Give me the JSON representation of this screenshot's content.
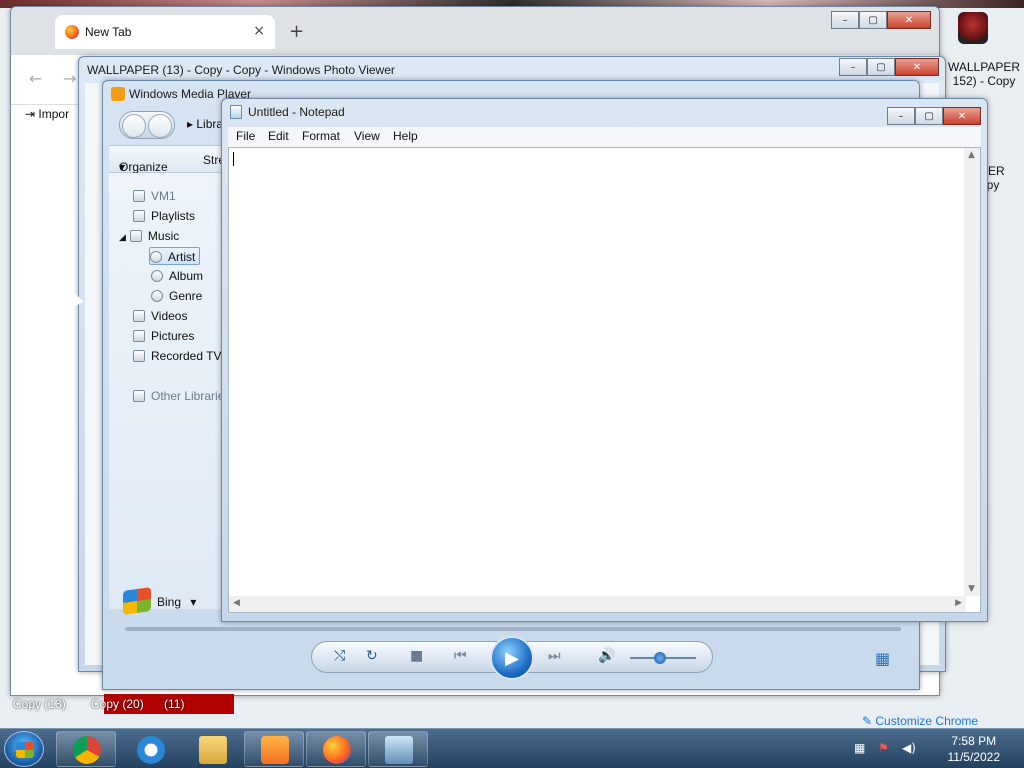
{
  "desktop": {
    "right_icons": [
      {
        "label": "WALLPAPER\n152) - Copy"
      },
      {
        "label": "PER\nopy"
      }
    ],
    "bottom_labels": [
      "Copy (13)",
      "Copy (20)",
      "(11)"
    ]
  },
  "chrome": {
    "tab_title": "New Tab",
    "tab_close": "×",
    "new_tab": "+",
    "back": "←",
    "forward": "→",
    "import_label": "Impor",
    "customize": "Customize Chrome"
  },
  "photo_viewer": {
    "title": "WALLPAPER (13) - Copy - Copy - Windows Photo Viewer"
  },
  "wmp": {
    "title": "Windows Media Player",
    "breadcrumb": "Libra",
    "toolbar": {
      "organize": "Organize",
      "stream": "Stre"
    },
    "nav": [
      {
        "label": "VM1"
      },
      {
        "label": "Playlists"
      },
      {
        "label": "Music"
      },
      {
        "label": "Artist"
      },
      {
        "label": "Album"
      },
      {
        "label": "Genre"
      },
      {
        "label": "Videos"
      },
      {
        "label": "Pictures"
      },
      {
        "label": "Recorded TV"
      },
      {
        "label": "Other Librarie"
      }
    ],
    "bing": "Bing",
    "controls": {
      "shuffle": "⤭",
      "repeat": "↻",
      "stop": "■",
      "previous": "⏮",
      "play": "▶",
      "next": "⏭",
      "mute": "🔊",
      "switch_view": "▦"
    },
    "volume": 0.45
  },
  "notepad": {
    "title": "Untitled - Notepad",
    "menu": [
      "File",
      "Edit",
      "Format",
      "View",
      "Help"
    ],
    "content": ""
  },
  "caption": {
    "minimize": "–",
    "maximize": "▢",
    "close": "✕"
  },
  "taskbar": {
    "time": "7:58 PM",
    "date": "11/5/2022"
  }
}
